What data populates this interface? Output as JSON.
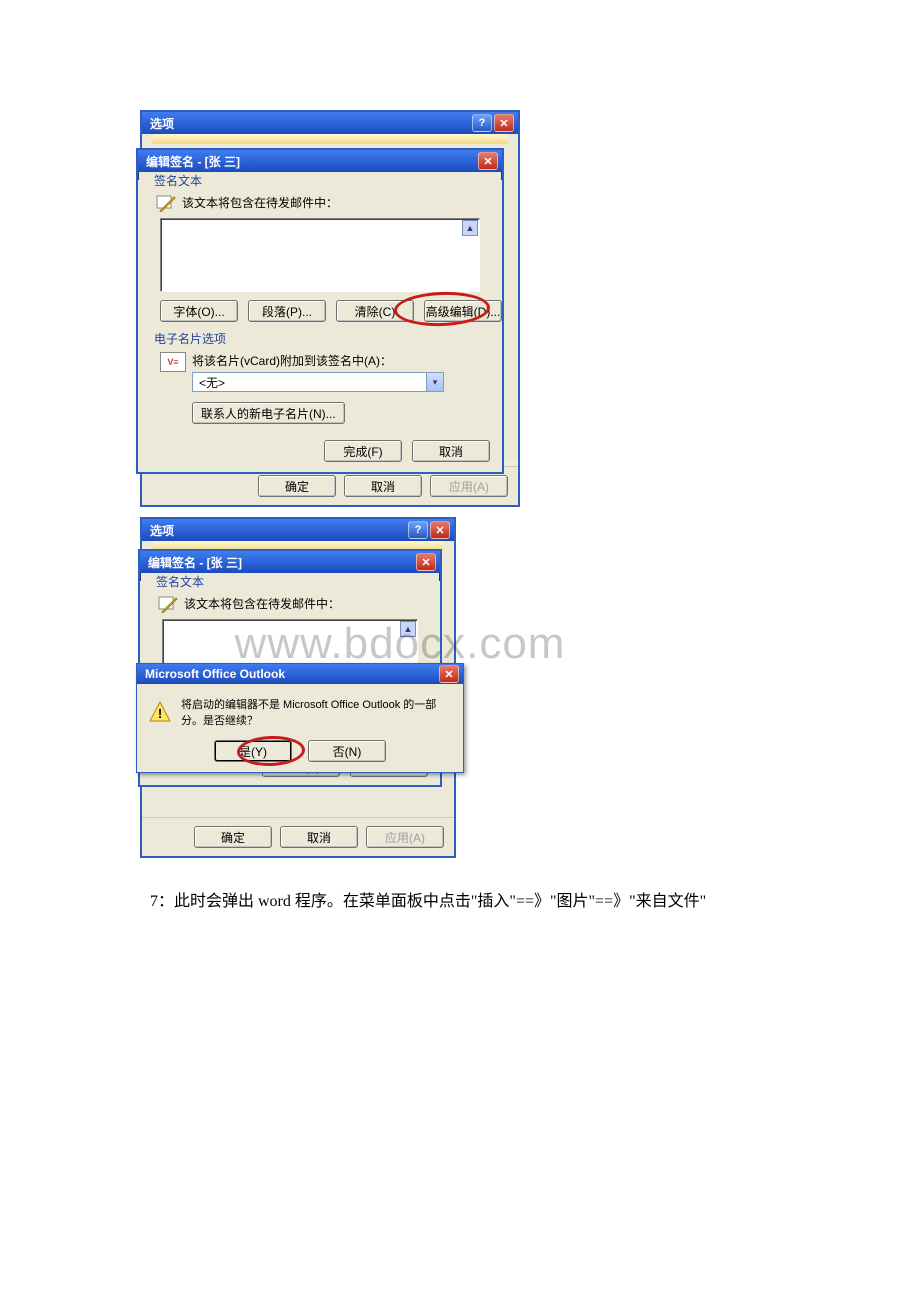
{
  "options_title": "选项",
  "edit_sig_title": "编辑签名 - [张 三]",
  "group_sig_text": "签名文本",
  "sig_inclusion_msg": "该文本将包含在待发邮件中：",
  "btn_font": "字体(O)...",
  "btn_paragraph": "段落(P)...",
  "btn_clear": "清除(C)",
  "btn_advanced_edit": "高级编辑(D)...",
  "group_vcard": "电子名片选项",
  "vcard_attach_msg": "将该名片(vCard)附加到该签名中(A)：",
  "vcard_selected": "<无>",
  "btn_new_vcard": "联系人的新电子名片(N)...",
  "btn_finish": "完成(F)",
  "btn_cancel": "取消",
  "btn_ok": "确定",
  "btn_apply": "应用(A)",
  "msgbox_title": "Microsoft Office Outlook",
  "msgbox_text": "将启动的编辑器不是 Microsoft Office Outlook 的一部分。是否继续？",
  "btn_yes": "是(Y)",
  "btn_no": "否(N)",
  "vcard_label": "V≡",
  "watermark_text": "www.bdocx.com",
  "explain_text": "7：此时会弹出 word 程序。在菜单面板中点击\"插入\"==》\"图片\"==》\"来自文件\""
}
